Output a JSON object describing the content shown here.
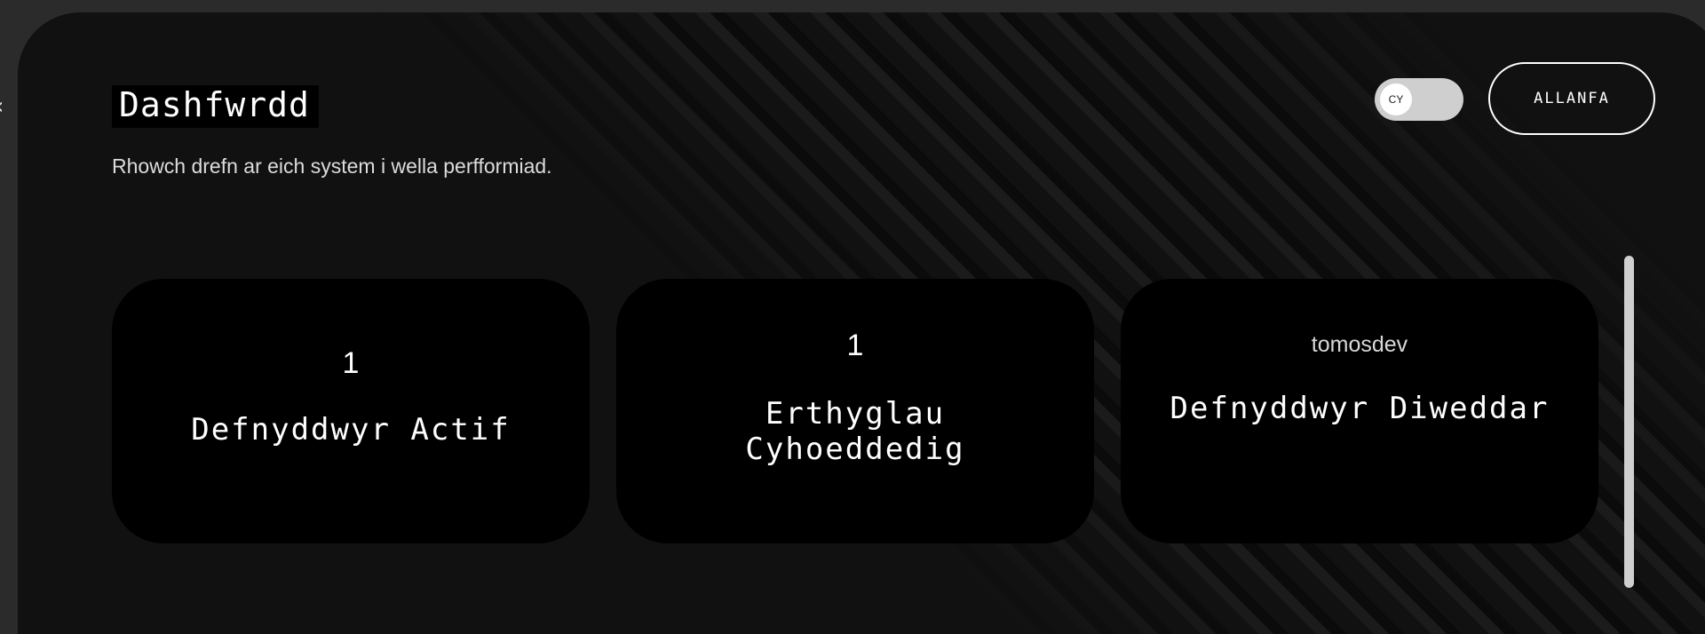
{
  "header": {
    "title": "Dashfwrdd",
    "subtitle": "Rhowch drefn ar eich system i wella perfformiad."
  },
  "language_toggle": {
    "label": "CY"
  },
  "logout_button": {
    "label": "ALLANFA"
  },
  "cards": [
    {
      "value": "1",
      "label": "Defnyddwyr Actif"
    },
    {
      "value": "1",
      "label": "Erthyglau Cyhoeddedig"
    },
    {
      "value": "tomosdev",
      "label": "Defnyddwyr Diweddar"
    }
  ],
  "icons": {
    "back": "chevron-left-icon"
  }
}
